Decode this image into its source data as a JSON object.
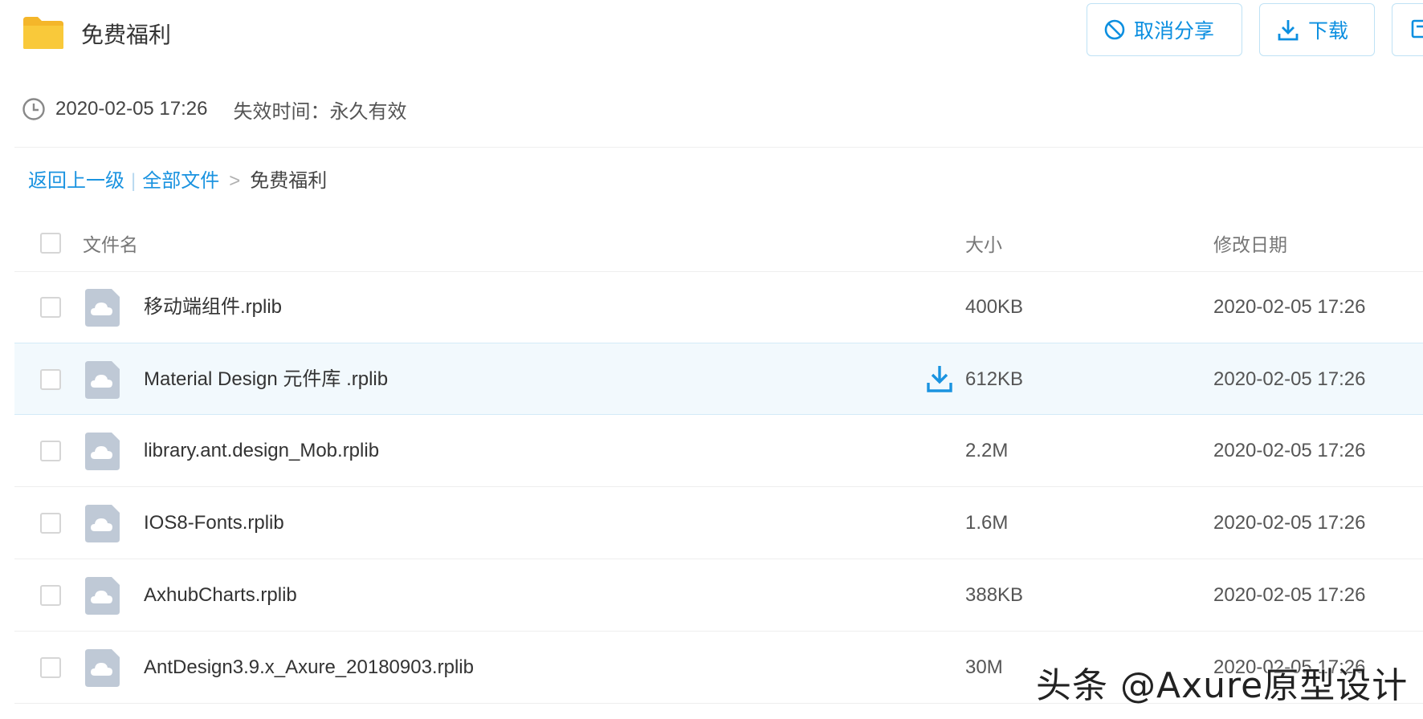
{
  "header": {
    "title": "免费福利",
    "cancel_share_label": "取消分享",
    "download_label": "下载"
  },
  "meta": {
    "share_time": "2020-02-05 17:26",
    "expire_label": "失效时间：永久有效"
  },
  "breadcrumb": {
    "back_label": "返回上一级",
    "separator": "|",
    "all_files_label": "全部文件",
    "arrow": ">",
    "current": "免费福利"
  },
  "table": {
    "columns": {
      "name": "文件名",
      "size": "大小",
      "date": "修改日期"
    },
    "rows": [
      {
        "name": "移动端组件.rplib",
        "size": "400KB",
        "date": "2020-02-05 17:26"
      },
      {
        "name": "Material Design 元件库 .rplib",
        "size": "612KB",
        "date": "2020-02-05 17:26"
      },
      {
        "name": "library.ant.design_Mob.rplib",
        "size": "2.2M",
        "date": "2020-02-05 17:26"
      },
      {
        "name": "IOS8-Fonts.rplib",
        "size": "1.6M",
        "date": "2020-02-05 17:26"
      },
      {
        "name": "AxhubCharts.rplib",
        "size": "388KB",
        "date": "2020-02-05 17:26"
      },
      {
        "name": "AntDesign3.9.x_Axure_20180903.rplib",
        "size": "30M",
        "date": "2020-02-05 17:26"
      }
    ]
  },
  "watermark": "头条 @Axure原型设计",
  "colors": {
    "accent": "#1a93e0",
    "folder": "#f7c531",
    "file_icon": "#bfc9d6",
    "row_hover": "#f2f9fd"
  }
}
